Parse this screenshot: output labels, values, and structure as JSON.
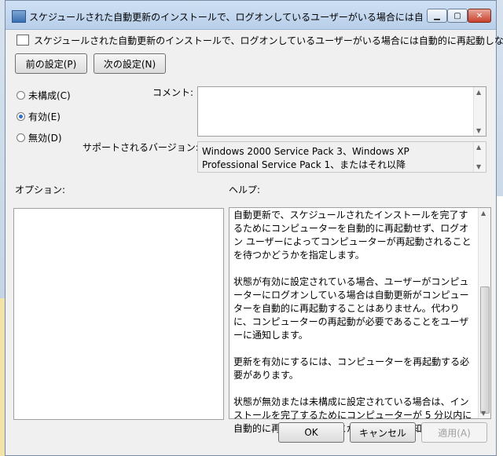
{
  "window": {
    "title": "スケジュールされた自動更新のインストールで、ログオンしているユーザーがいる場合には自動的に...",
    "subtitle": "スケジュールされた自動更新のインストールで、ログオンしているユーザーがいる場合には自動的に再起動しない"
  },
  "nav": {
    "prev": "前の設定(P)",
    "next": "次の設定(N)"
  },
  "radios": [
    {
      "label": "未構成(C)",
      "checked": false
    },
    {
      "label": "有効(E)",
      "checked": true
    },
    {
      "label": "無効(D)",
      "checked": false
    }
  ],
  "comment_label": "コメント:",
  "supported_label": "サポートされるバージョン:",
  "supported_text": "Windows 2000 Service Pack 3、Windows XP Professional Service Pack 1、またはそれ以降",
  "options_label": "オプション:",
  "help_label": "ヘルプ:",
  "help_paragraphs": [
    "自動更新で、スケジュールされたインストールを完了するためにコンピューターを自動的に再起動せず、ログオン ユーザーによってコンピューターが再起動されることを待つかどうかを指定します。",
    "状態が有効に設定されている場合、ユーザーがコンピューターにログオンしている場合は自動更新がコンピューターを自動的に再起動することはありません。代わりに、コンピューターの再起動が必要であることをユーザーに通知します。",
    "更新を有効にするには、コンピューターを再起動する必要があります。",
    "状態が無効または未構成に設定されている場合は、インストールを完了するためにコンピューターが 5 分以内に自動的に再起動されることがユーザーに通知されます。"
  ],
  "buttons": {
    "ok": "OK",
    "cancel": "キャンセル",
    "apply": "適用(A)"
  }
}
